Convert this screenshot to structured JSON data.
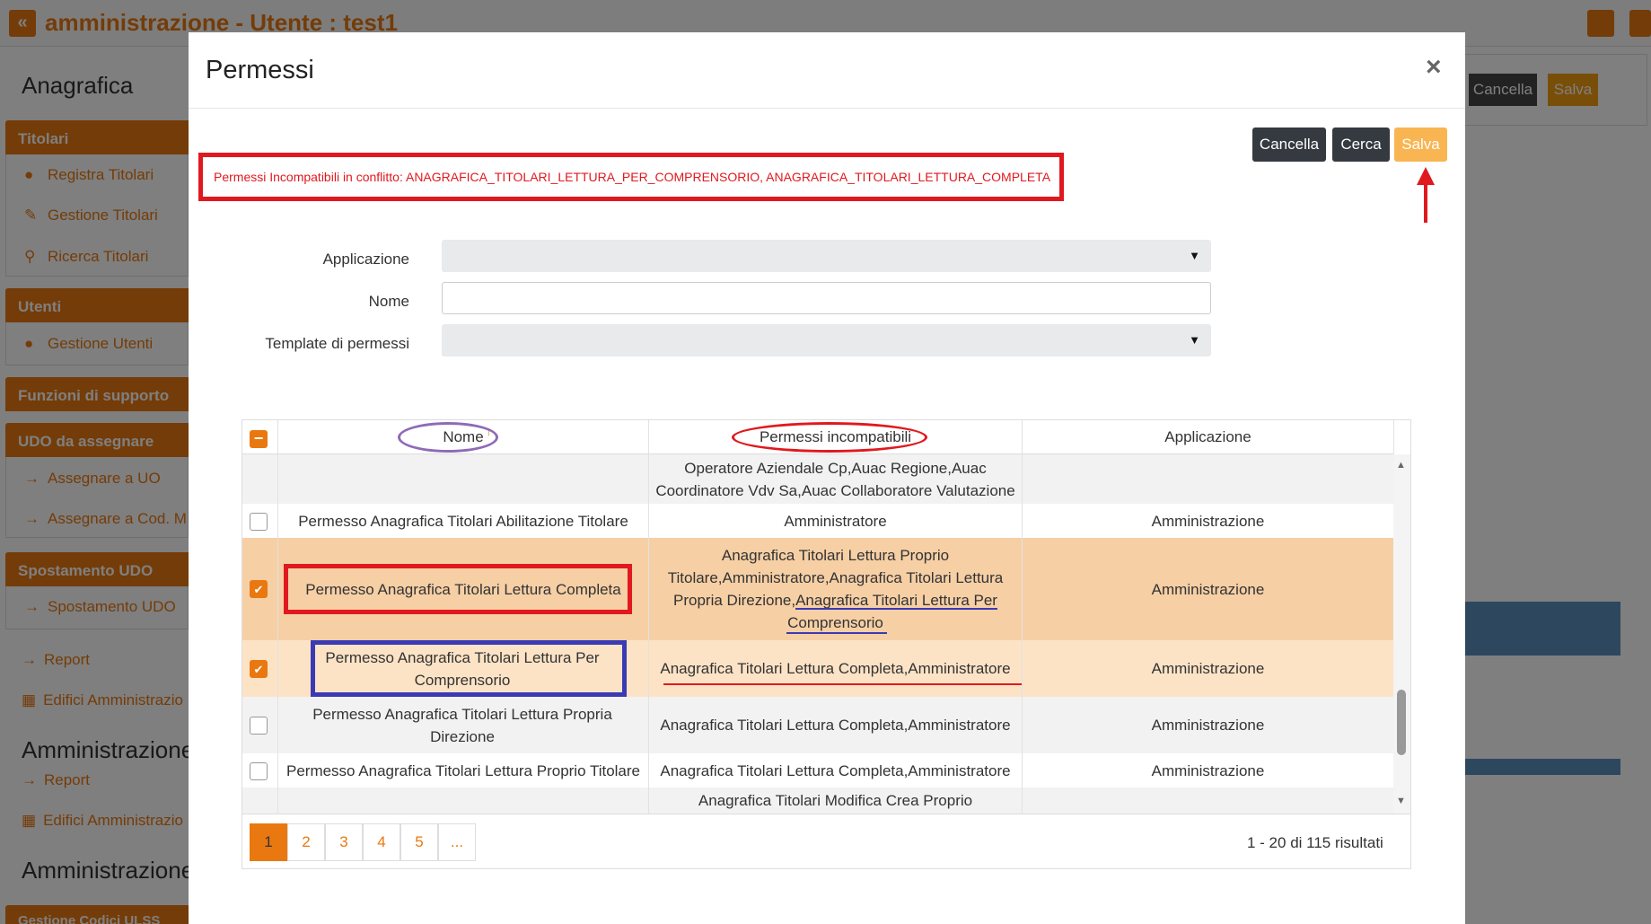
{
  "app": {
    "title": "amministrazione - Utente : test1",
    "collapse_glyph": "«",
    "top_icons": [
      "globe-icon",
      "power-icon"
    ]
  },
  "sidebar": {
    "title": "Anagrafica",
    "groups": [
      {
        "label": "Titolari",
        "items": [
          {
            "label": "Registra Titolari",
            "icon": "user-plus-icon"
          },
          {
            "label": "Gestione Titolari",
            "icon": "edit-icon"
          },
          {
            "label": "Ricerca Titolari",
            "icon": "search-icon"
          }
        ]
      },
      {
        "label": "Utenti",
        "items": [
          {
            "label": "Gestione Utenti",
            "icon": "user-edit-icon"
          }
        ]
      },
      {
        "label": "Funzioni di supporto",
        "items": []
      },
      {
        "label": "UDO da assegnare",
        "items": [
          {
            "label": "Assegnare a UO",
            "icon": "arrow-right-icon"
          },
          {
            "label": "Assegnare a Cod. M",
            "icon": "arrow-right-icon"
          }
        ]
      },
      {
        "label": "Spostamento UDO",
        "items": [
          {
            "label": "Spostamento UDO",
            "icon": "arrow-right-icon"
          }
        ]
      }
    ],
    "plain_items": [
      {
        "label": "Report",
        "icon": "arrow-right-icon"
      },
      {
        "label": "Edifici Amministrazio",
        "icon": "building-icon"
      }
    ],
    "section2_title": "Amministrazione",
    "section2_items": [
      {
        "label": "Report",
        "icon": "arrow-right-icon"
      },
      {
        "label": "Edifici Amministrazio",
        "icon": "building-icon"
      }
    ],
    "section3_title": "Amministrazione",
    "last_group": "Gestione Codici ULSS"
  },
  "background_actions": {
    "cancel": "Cancella",
    "save": "Salva"
  },
  "modal": {
    "title": "Permessi",
    "close": "×",
    "buttons": {
      "cancel": "Cancella",
      "search": "Cerca",
      "save": "Salva"
    },
    "error_message": "Permessi Incompatibili in conflitto: ANAGRAFICA_TITOLARI_LETTURA_PER_COMPRENSORIO, ANAGRAFICA_TITOLARI_LETTURA_COMPLETA",
    "form": {
      "applicazione_label": "Applicazione",
      "applicazione_value": "",
      "nome_label": "Nome",
      "nome_value": "",
      "template_label": "Template di permessi",
      "template_value": ""
    },
    "table": {
      "columns": [
        "Nome",
        "Permessi incompatibili",
        "Applicazione"
      ],
      "sort_indicator": "↑",
      "rows": [
        {
          "checked": false,
          "nome": "",
          "incompatibili": "Operatore Aziendale Cp,Auac Regione,Auac Coordinatore Vdv Sa,Auac Collaboratore Valutazione",
          "applicazione": ""
        },
        {
          "checked": false,
          "nome": "Permesso Anagrafica Titolari Abilitazione Titolare",
          "incompatibili": "Amministratore",
          "applicazione": "Amministrazione"
        },
        {
          "checked": true,
          "nome": "Permesso Anagrafica Titolari Lettura Completa",
          "incompatibili": "Anagrafica Titolari Lettura Proprio Titolare,Amministratore,Anagrafica Titolari Lettura Propria Direzione,Anagrafica Titolari Lettura Per Comprensorio",
          "applicazione": "Amministrazione"
        },
        {
          "checked": true,
          "nome": "Permesso Anagrafica Titolari Lettura Per Comprensorio",
          "incompatibili": "Anagrafica Titolari Lettura Completa,Amministratore",
          "applicazione": "Amministrazione"
        },
        {
          "checked": false,
          "nome": "Permesso Anagrafica Titolari Lettura Propria Direzione",
          "incompatibili": "Anagrafica Titolari Lettura Completa,Amministratore",
          "applicazione": "Amministrazione"
        },
        {
          "checked": false,
          "nome": "Permesso Anagrafica Titolari Lettura Proprio Titolare",
          "incompatibili": "Anagrafica Titolari Lettura Completa,Amministratore",
          "applicazione": "Amministrazione"
        },
        {
          "checked": false,
          "nome": "",
          "incompatibili": "Anagrafica Titolari Modifica Crea Proprio",
          "applicazione": ""
        }
      ]
    },
    "pager": {
      "pages": [
        "1",
        "2",
        "3",
        "4",
        "5",
        "..."
      ],
      "active_page": "1",
      "results": "1 - 20 di 115 risultati"
    }
  },
  "colors": {
    "accent": "#e97811",
    "selected_row": "#f8d7b4",
    "annotation_red": "#e0191f",
    "annotation_blue": "#3a3ab5",
    "annotation_purple": "#8e6bb8"
  }
}
